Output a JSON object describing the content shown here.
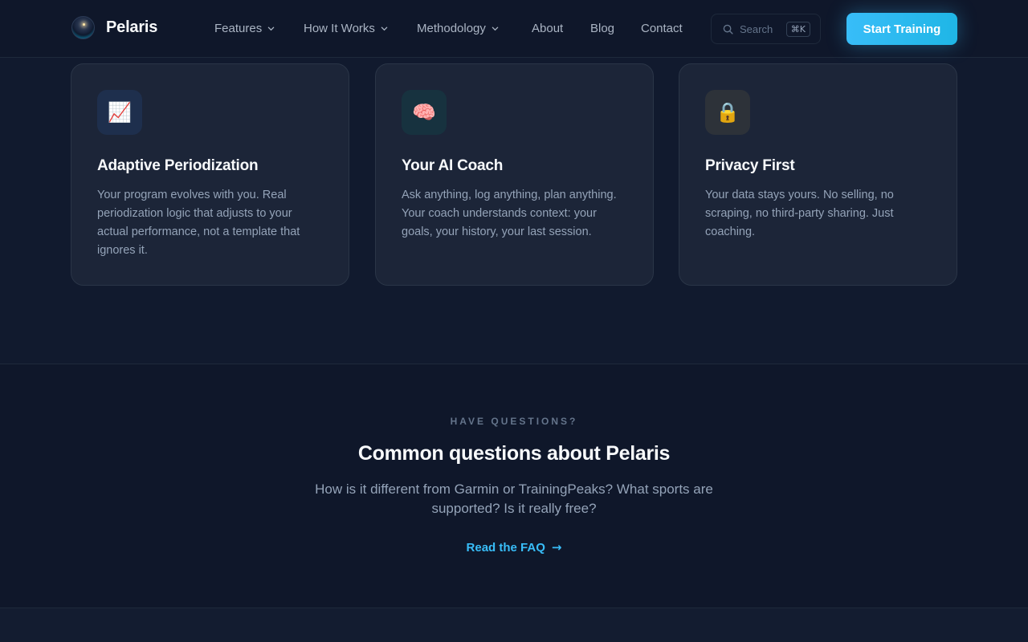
{
  "nav": {
    "brand": "Pelaris",
    "links": [
      {
        "label": "Features",
        "dropdown": true
      },
      {
        "label": "How It Works",
        "dropdown": true
      },
      {
        "label": "Methodology",
        "dropdown": true
      },
      {
        "label": "About",
        "dropdown": false
      },
      {
        "label": "Blog",
        "dropdown": false
      },
      {
        "label": "Contact",
        "dropdown": false
      }
    ],
    "search": {
      "placeholder": "Search",
      "shortcut": "⌘K"
    },
    "cta": "Start Training"
  },
  "features": [
    {
      "icon": "chart-increasing-icon",
      "emoji": "📈",
      "icon_bg": "#1e2f4d",
      "title": "Adaptive Periodization",
      "description": "Your program evolves with you. Real periodization logic that adjusts to your actual performance, not a template that ignores it."
    },
    {
      "icon": "brain-icon",
      "emoji": "🧠",
      "icon_bg": "#17323f",
      "title": "Your AI Coach",
      "description": "Ask anything, log anything, plan anything. Your coach understands context: your goals, your history, your last session."
    },
    {
      "icon": "lock-icon",
      "emoji": "🔒",
      "icon_bg": "#2d3239",
      "title": "Privacy First",
      "description": "Your data stays yours. No selling, no scraping, no third-party sharing. Just coaching."
    }
  ],
  "faq": {
    "eyebrow": "HAVE QUESTIONS?",
    "title": "Common questions about Pelaris",
    "subtitle": "How is it different from Garmin or TrainingPeaks? What sports are supported? Is it really free?",
    "link": "Read the FAQ",
    "link_arrow": "→"
  },
  "colors": {
    "accent": "#38bdf8",
    "background": "#0f172a",
    "card": "#1c2538"
  }
}
